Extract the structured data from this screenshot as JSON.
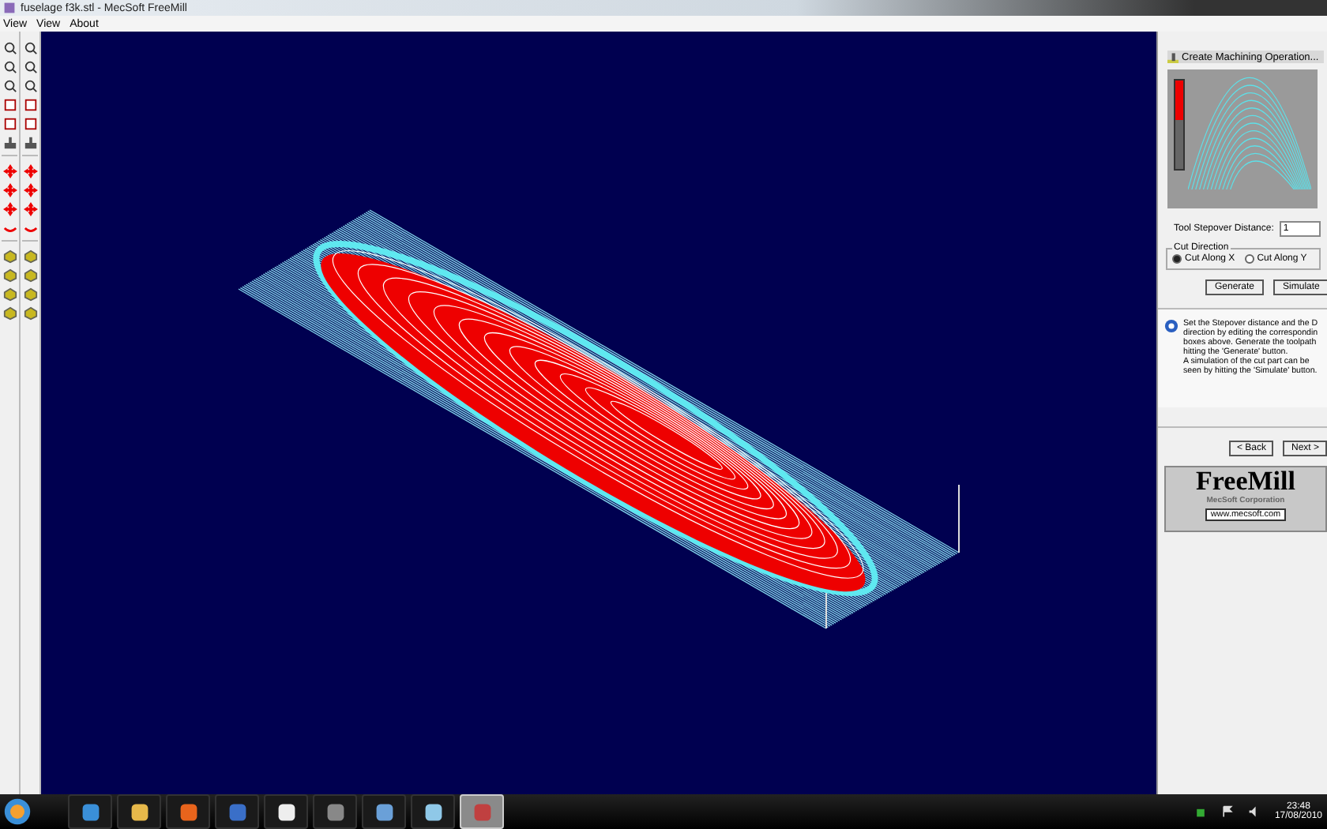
{
  "window": {
    "title": "fuselage f3k.stl - MecSoft  FreeMill"
  },
  "menu": [
    "View",
    "View",
    "About"
  ],
  "panel": {
    "header": "Create Machining Operation...",
    "gauge": {
      "level": 0.45
    },
    "stepover": {
      "label": "Tool Stepover Distance:",
      "value": "1"
    },
    "cut_direction": {
      "title": "Cut Direction",
      "options": [
        {
          "label": "Cut Along X",
          "selected": true
        },
        {
          "label": "Cut Along Y",
          "selected": false
        }
      ]
    },
    "buttons": [
      "Generate",
      "Simulate"
    ],
    "help_lines": [
      "Set the Stepover distance and the D",
      "direction by editing the correspondin",
      "boxes above. Generate the toolpath",
      "hitting the 'Generate' button.",
      "A simulation of the cut part can be",
      "seen by hitting the 'Simulate' button."
    ],
    "nav_buttons": [
      "< Back",
      "Next >"
    ],
    "logo": {
      "name": "FreeMill",
      "company": "MecSoft Corporation",
      "link": "www.mecsoft.com"
    }
  },
  "taskbar": {
    "apps": [
      {
        "selected": false
      },
      {
        "selected": false
      },
      {
        "selected": false
      },
      {
        "selected": false
      },
      {
        "selected": false
      },
      {
        "selected": false
      },
      {
        "selected": false
      },
      {
        "selected": false
      },
      {
        "selected": true
      }
    ],
    "time": "23:48",
    "date": "17/08/2010"
  }
}
